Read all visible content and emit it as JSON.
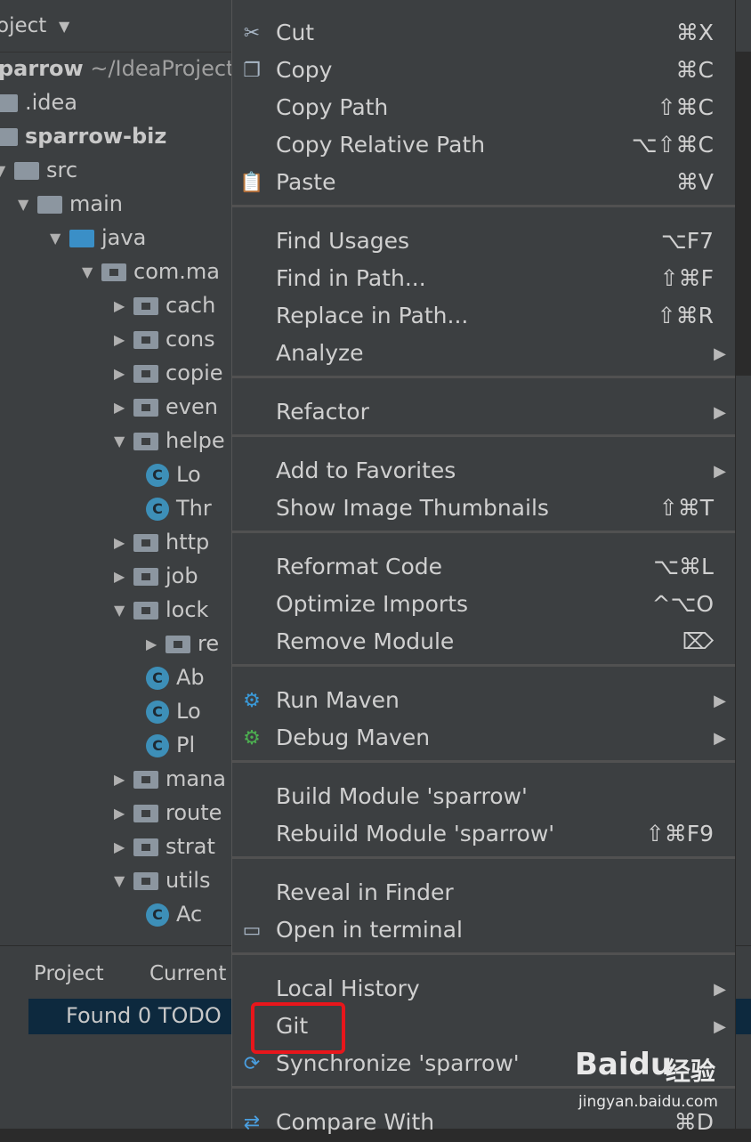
{
  "project_panel": {
    "header_title": "oject",
    "tree": [
      {
        "label": "parrow",
        "suffix": "~/IdeaProject",
        "bold": true
      },
      {
        "label": ".idea"
      },
      {
        "label": "sparrow-biz",
        "bold": true
      },
      {
        "label": "src"
      },
      {
        "label": "main"
      },
      {
        "label": "java"
      },
      {
        "label": "com.ma"
      },
      {
        "label": "cach"
      },
      {
        "label": "cons"
      },
      {
        "label": "copie"
      },
      {
        "label": "even"
      },
      {
        "label": "helpe"
      },
      {
        "label": "Lo"
      },
      {
        "label": "Thr"
      },
      {
        "label": "http"
      },
      {
        "label": "job"
      },
      {
        "label": "lock"
      },
      {
        "label": "re"
      },
      {
        "label": "Ab"
      },
      {
        "label": "Lo"
      },
      {
        "label": "Pl"
      },
      {
        "label": "mana"
      },
      {
        "label": "route"
      },
      {
        "label": "strat"
      },
      {
        "label": "utils"
      },
      {
        "label": "Ac"
      }
    ],
    "bottom_tabs": [
      "Project",
      "Current"
    ],
    "todo_text": "Found 0 TODO"
  },
  "context_menu": {
    "groups": [
      [
        {
          "label": "Cut",
          "shortcut": "⌘X",
          "icon": "scissors-icon"
        },
        {
          "label": "Copy",
          "shortcut": "⌘C",
          "icon": "copy-icon"
        },
        {
          "label": "Copy Path",
          "shortcut": "⇧⌘C"
        },
        {
          "label": "Copy Relative Path",
          "shortcut": "⌥⇧⌘C"
        },
        {
          "label": "Paste",
          "shortcut": "⌘V",
          "icon": "paste-icon"
        }
      ],
      [
        {
          "label": "Find Usages",
          "shortcut": "⌥F7"
        },
        {
          "label": "Find in Path...",
          "shortcut": "⇧⌘F"
        },
        {
          "label": "Replace in Path...",
          "shortcut": "⇧⌘R"
        },
        {
          "label": "Analyze",
          "submenu": true
        }
      ],
      [
        {
          "label": "Refactor",
          "submenu": true
        }
      ],
      [
        {
          "label": "Add to Favorites",
          "submenu": true
        },
        {
          "label": "Show Image Thumbnails",
          "shortcut": "⇧⌘T"
        }
      ],
      [
        {
          "label": "Reformat Code",
          "shortcut": "⌥⌘L"
        },
        {
          "label": "Optimize Imports",
          "shortcut": "^⌥O"
        },
        {
          "label": "Remove Module",
          "shortcut": "⌦"
        }
      ],
      [
        {
          "label": "Run Maven",
          "submenu": true,
          "icon": "gear-icon"
        },
        {
          "label": "Debug Maven",
          "submenu": true,
          "icon": "debug-gear-icon"
        }
      ],
      [
        {
          "label": "Build Module 'sparrow'"
        },
        {
          "label": "Rebuild Module 'sparrow'",
          "shortcut": "⇧⌘F9"
        }
      ],
      [
        {
          "label": "Reveal in Finder"
        },
        {
          "label": "Open in terminal",
          "icon": "terminal-icon"
        }
      ],
      [
        {
          "label": "Local History",
          "submenu": true
        },
        {
          "label": "Git",
          "submenu": true
        },
        {
          "label": "Synchronize 'sparrow'",
          "icon": "sync-icon"
        }
      ],
      [
        {
          "label": "Compare With",
          "shortcut": "⌘D",
          "icon": "compare-icon"
        }
      ]
    ]
  },
  "watermark": {
    "brand": "Baidu",
    "cn": "经验",
    "url": "jingyan.baidu.com"
  },
  "colors": {
    "menu_bg": "#3c3f41",
    "highlight": "#e8161b",
    "todo_bg": "#0d293e"
  }
}
